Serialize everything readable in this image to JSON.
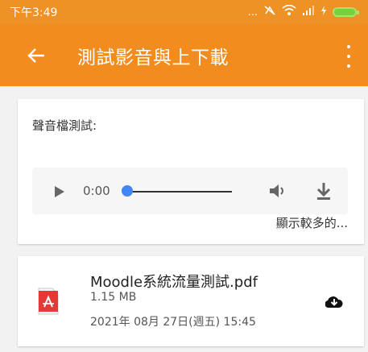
{
  "statusbar": {
    "time": "下午3:49",
    "icons": [
      "dots-icon",
      "data-off-icon",
      "wifi-icon",
      "signal-icon",
      "battery-charging-icon"
    ],
    "dots": "..."
  },
  "appbar": {
    "title": "測試影音與上下載",
    "back_icon": "arrow-left-icon",
    "more_icon": "more-vertical-icon",
    "color": "#f28c1f"
  },
  "audio": {
    "label": "聲音檔測試:",
    "time": "0:00",
    "progress": 0,
    "show_more": "顯示較多的..."
  },
  "file": {
    "name": "Moodle系統流量測試.pdf",
    "size": "1.15 MB",
    "date": "2021年 08月 27日(週五) 15:45",
    "type_icon": "pdf-icon",
    "action_icon": "cloud-download-icon"
  }
}
